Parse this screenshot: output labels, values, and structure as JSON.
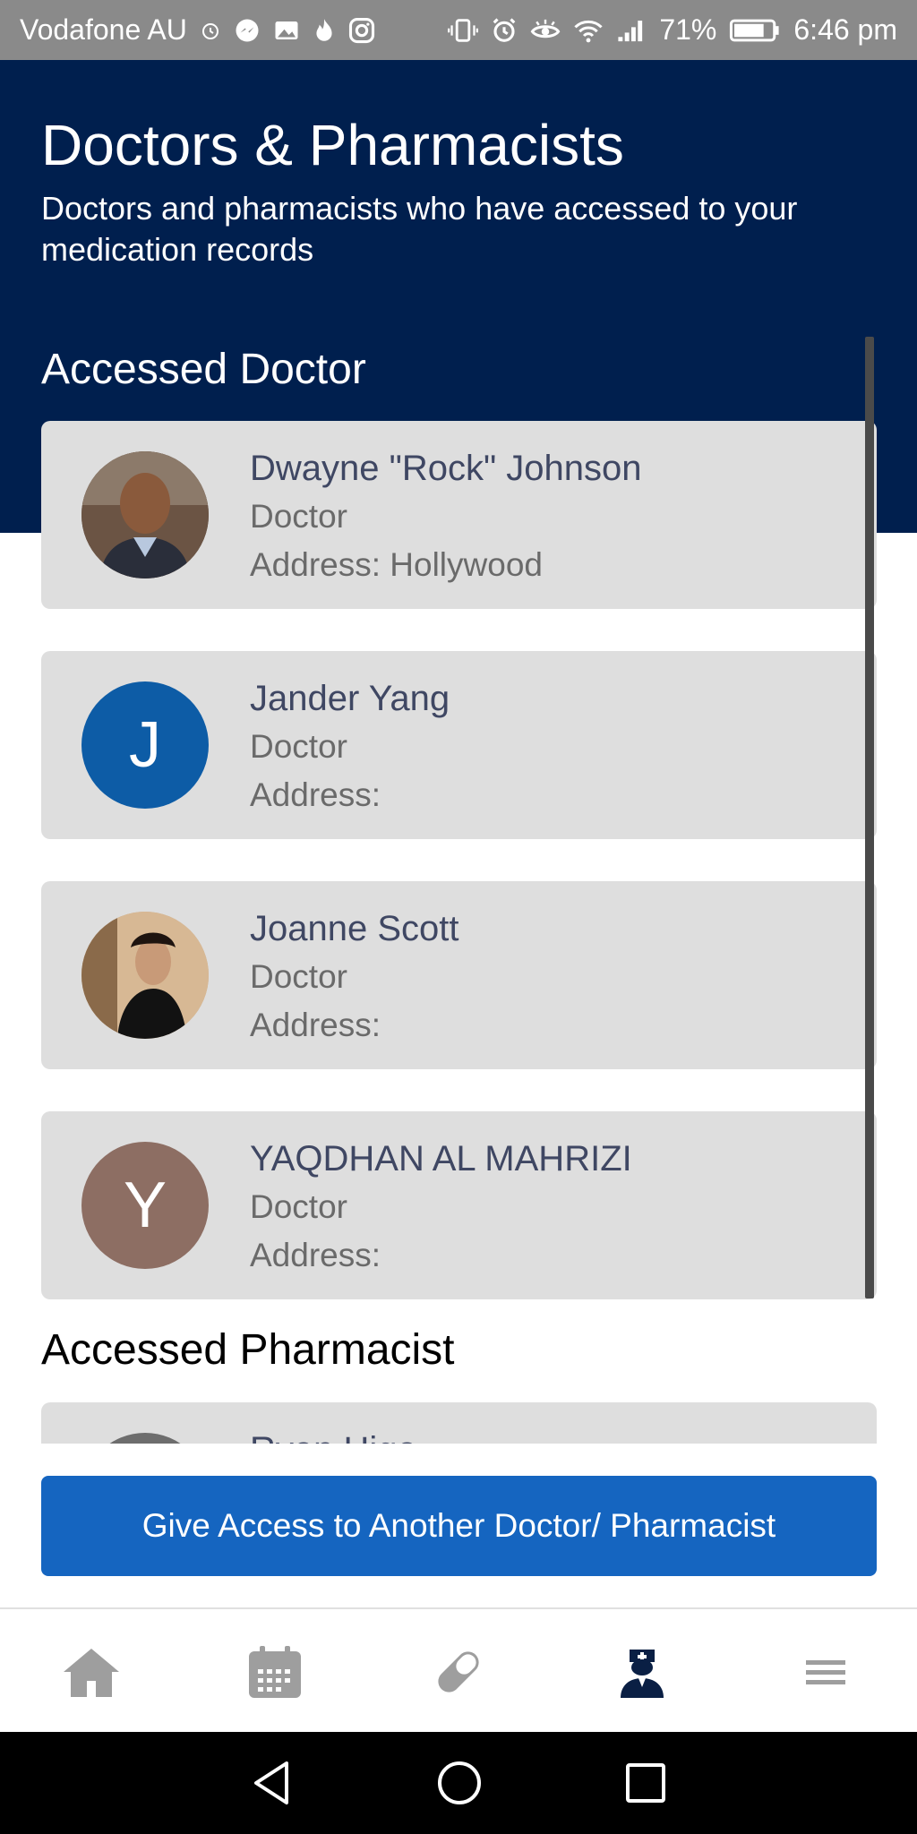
{
  "status_bar": {
    "carrier": "Vodafone AU",
    "battery": "71%",
    "time": "6:46 pm"
  },
  "header": {
    "title": "Doctors & Pharmacists",
    "subtitle": "Doctors and pharmacists who have accessed to your medication records"
  },
  "sections": {
    "doctor_title": "Accessed Doctor",
    "pharmacist_title": "Accessed Pharmacist"
  },
  "doctors": [
    {
      "name": "Dwayne \"Rock\" Johnson",
      "role": "Doctor",
      "address": "Address: Hollywood",
      "avatar": "photo"
    },
    {
      "name": "Jander Yang",
      "role": "Doctor",
      "address": "Address:",
      "avatar_letter": "J",
      "avatar_color": "#0d5ca6"
    },
    {
      "name": "Joanne Scott",
      "role": "Doctor",
      "address": "Address:",
      "avatar": "photo"
    },
    {
      "name": "YAQDHAN AL MAHRIZI",
      "role": "Doctor",
      "address": "Address:",
      "avatar_letter": "Y",
      "avatar_color": "#8d6e63"
    }
  ],
  "pharmacists": [
    {
      "name": "Ryan Higa"
    }
  ],
  "actions": {
    "give_access_label": "Give Access to Another Doctor/ Pharmacist"
  },
  "bottom_nav": {
    "items": [
      "home-icon",
      "calendar-icon",
      "pill-icon",
      "doctor-icon",
      "menu-icon"
    ],
    "active": "doctor-icon",
    "active_color": "#0a1f44",
    "inactive_color": "#9e9e9e"
  },
  "colors": {
    "header_bg": "#001f4e",
    "card_bg": "#dedede",
    "button_bg": "#1565c0"
  }
}
